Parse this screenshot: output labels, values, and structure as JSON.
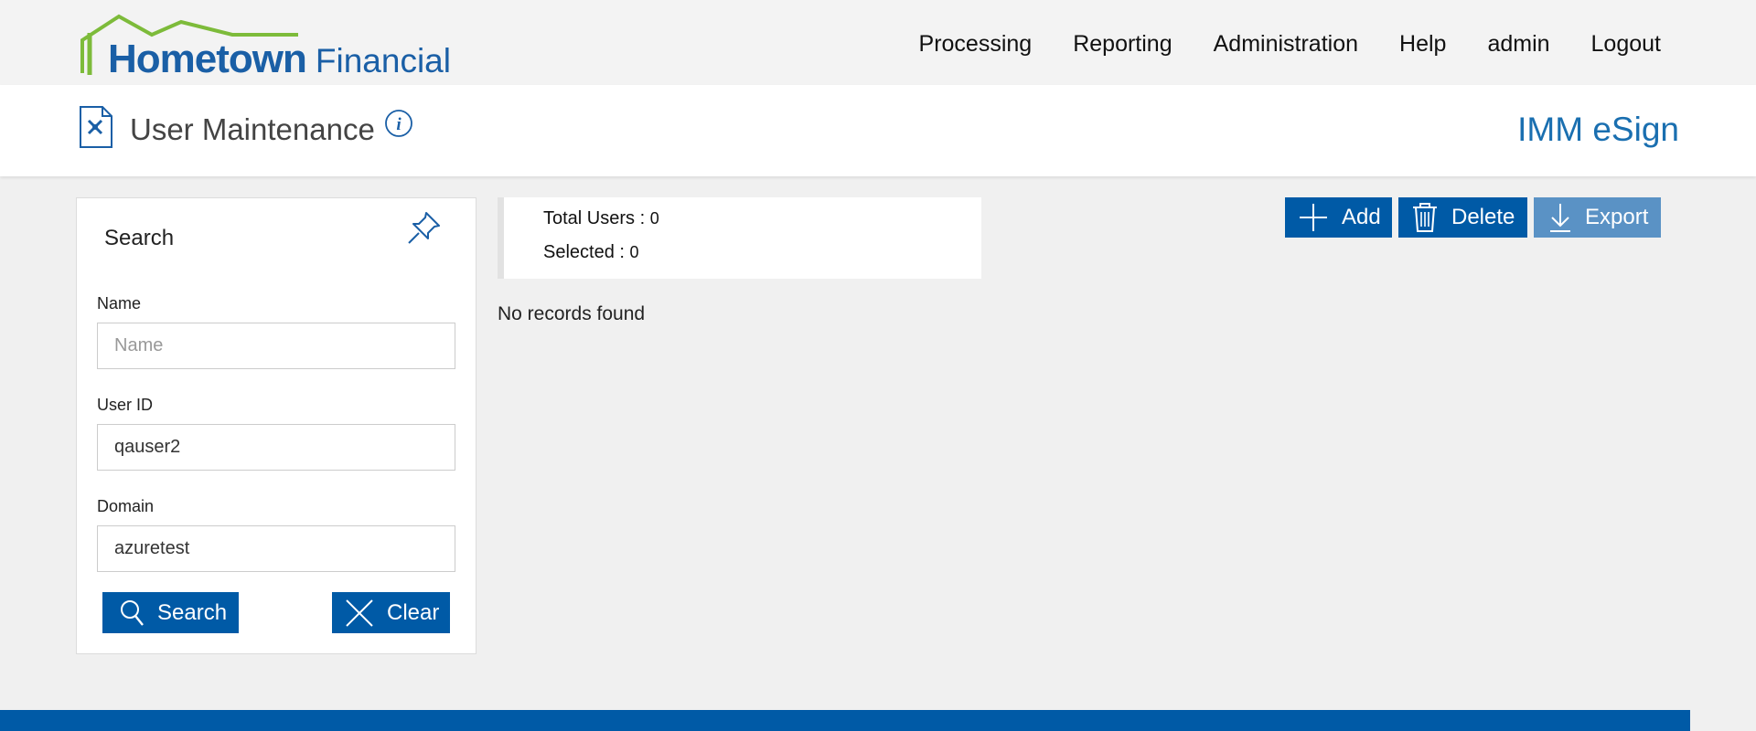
{
  "brand": {
    "logo_main": "Hometown",
    "logo_sub": "Financial",
    "product": "IMM eSign"
  },
  "nav": [
    {
      "label": "Processing"
    },
    {
      "label": "Reporting"
    },
    {
      "label": "Administration"
    },
    {
      "label": "Help"
    },
    {
      "label": "admin"
    },
    {
      "label": "Logout"
    }
  ],
  "page": {
    "title": "User Maintenance",
    "title_icon": "document-tools-icon",
    "info_icon": "info-icon"
  },
  "search": {
    "title": "Search",
    "pin_icon": "pin-icon",
    "fields": {
      "name": {
        "label": "Name",
        "placeholder": "Name",
        "value": ""
      },
      "user_id": {
        "label": "User ID",
        "placeholder": "",
        "value": "qauser2"
      },
      "domain": {
        "label": "Domain",
        "placeholder": "",
        "value": "azuretest"
      }
    },
    "search_label": "Search",
    "clear_label": "Clear"
  },
  "summary": {
    "total_label": "Total Users : ",
    "total_value": "0",
    "selected_label": "Selected : ",
    "selected_value": "0"
  },
  "results": {
    "empty_message": "No records found"
  },
  "actions": {
    "add_label": "Add",
    "delete_label": "Delete",
    "export_label": "Export"
  },
  "colors": {
    "primary": "#005aa6",
    "disabled": "#5a92c5",
    "logo_green": "#7dbb3a",
    "logo_blue": "#1a5fa6"
  }
}
